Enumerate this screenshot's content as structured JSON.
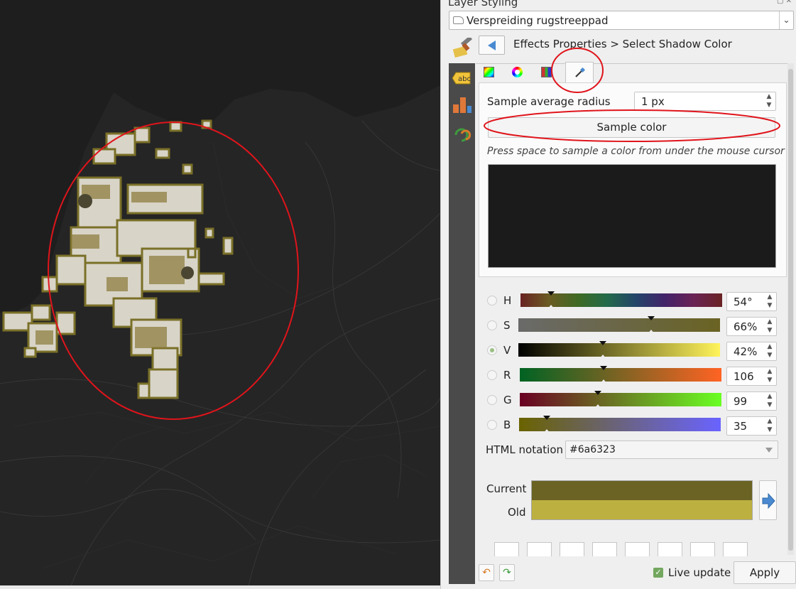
{
  "panel": {
    "title": "Layer Styling",
    "layer_name": "Verspreiding rugstreeppad",
    "breadcrumb": "Effects Properties > Select Shadow Color"
  },
  "sampler": {
    "radius_label": "Sample average radius",
    "radius_value": "1 px",
    "sample_button": "Sample color",
    "hint": "Press space to sample a color from under the mouse cursor"
  },
  "sliders": [
    {
      "label": "H",
      "value": "54°",
      "fraction": 0.15,
      "selected": false
    },
    {
      "label": "S",
      "value": "66%",
      "fraction": 0.66,
      "selected": false
    },
    {
      "label": "V",
      "value": "42%",
      "fraction": 0.42,
      "selected": true
    },
    {
      "label": "R",
      "value": "106",
      "fraction": 0.415,
      "selected": false
    },
    {
      "label": "G",
      "value": "99",
      "fraction": 0.388,
      "selected": false
    },
    {
      "label": "B",
      "value": "35",
      "fraction": 0.137,
      "selected": false
    }
  ],
  "html_notation": {
    "label": "HTML notation",
    "value": "#6a6323"
  },
  "preview": {
    "current_label": "Current",
    "old_label": "Old",
    "current_color": "#6a6323",
    "old_color": "#bcb040"
  },
  "footer": {
    "live_update": "Live update",
    "apply": "Apply"
  },
  "colors": {
    "map_bg": "#252525",
    "annotation": "#e0141b",
    "sample_preview": "#1b1b1b"
  }
}
